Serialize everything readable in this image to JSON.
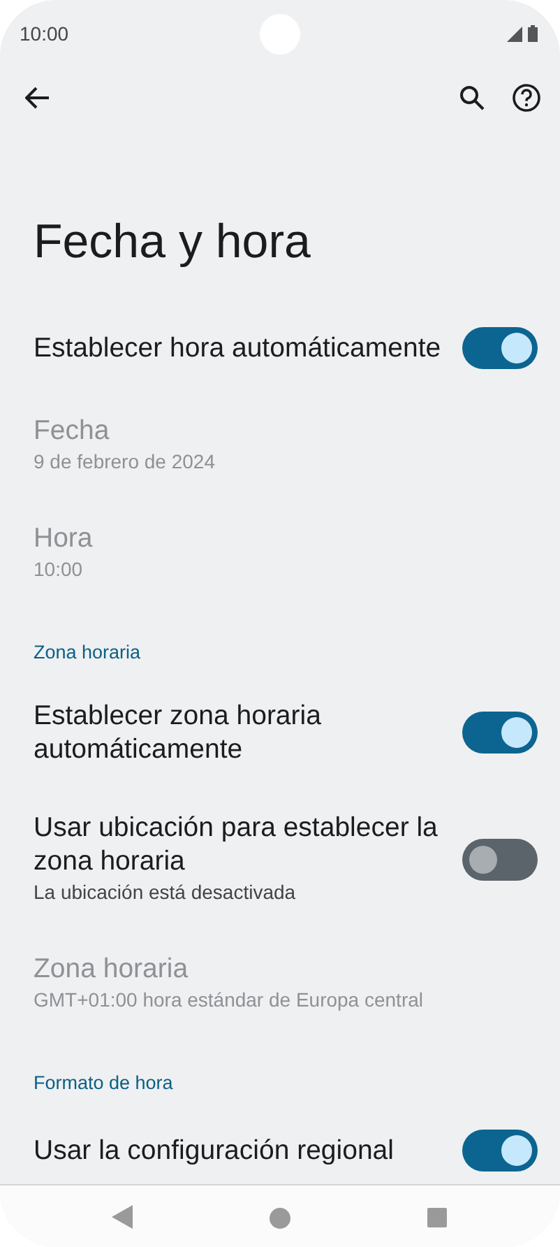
{
  "status_bar": {
    "time": "10:00"
  },
  "title": "Fecha y hora",
  "items": [
    {
      "kind": "toggle",
      "title": "Establecer hora automáticamente",
      "on": true,
      "disabled": false
    },
    {
      "kind": "info",
      "title": "Fecha",
      "summary": "9 de febrero de 2024",
      "disabled": true
    },
    {
      "kind": "info",
      "title": "Hora",
      "summary": "10:00",
      "disabled": true
    },
    {
      "kind": "header",
      "title": "Zona horaria"
    },
    {
      "kind": "toggle",
      "title": "Establecer zona horaria automáticamente",
      "on": true,
      "disabled": false
    },
    {
      "kind": "toggle",
      "title": "Usar ubicación para establecer la zona horaria",
      "summary": "La ubicación está desactivada",
      "on": false,
      "disabled": false
    },
    {
      "kind": "info",
      "title": "Zona horaria",
      "summary": "GMT+01:00 hora estándar de Europa central",
      "disabled": true
    },
    {
      "kind": "header",
      "title": "Formato de hora"
    },
    {
      "kind": "toggle",
      "title": "Usar la configuración regional",
      "on": true,
      "disabled": false
    }
  ]
}
